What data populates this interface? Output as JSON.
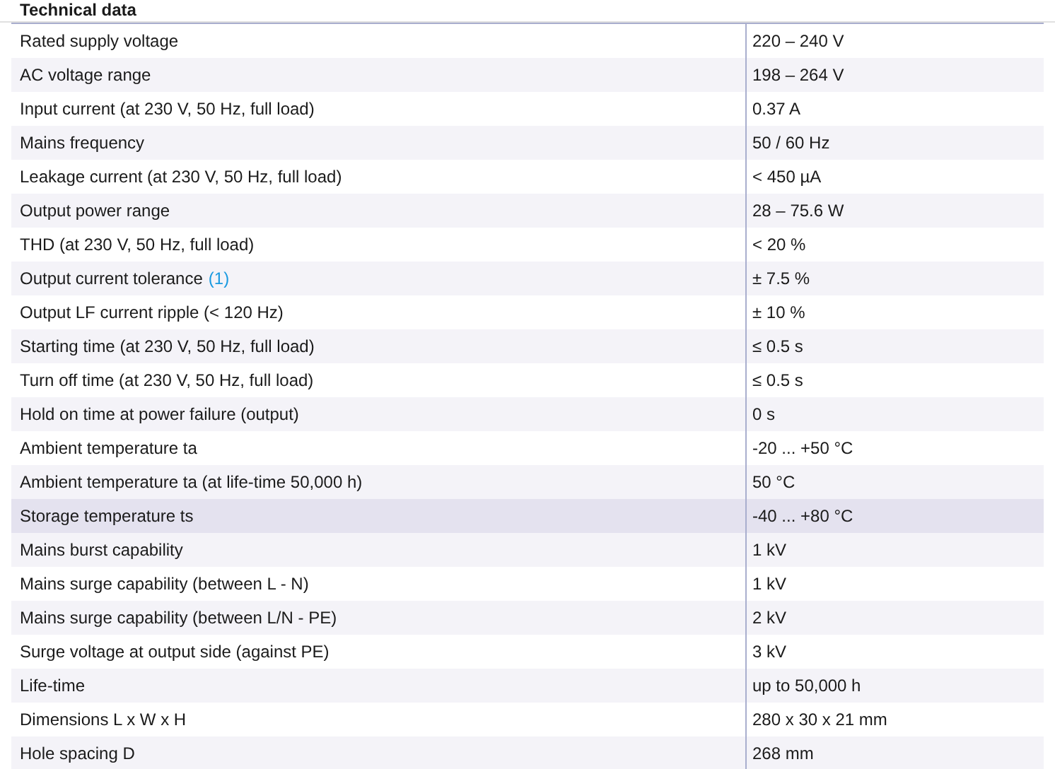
{
  "heading": "Technical data",
  "rows": [
    {
      "label": "Rated supply voltage",
      "value": "220 – 240 V",
      "selected": false
    },
    {
      "label": "AC voltage range",
      "value": "198 – 264 V",
      "selected": false
    },
    {
      "label": "Input current (at 230 V, 50 Hz, full load)",
      "value": "0.37 A",
      "selected": false
    },
    {
      "label": "Mains frequency",
      "value": "50 / 60 Hz",
      "selected": false
    },
    {
      "label": "Leakage current (at 230 V, 50 Hz, full load)",
      "value": "< 450 µA",
      "selected": false
    },
    {
      "label": "Output power range",
      "value": "28 – 75.6 W",
      "selected": false
    },
    {
      "label": "THD (at 230 V, 50 Hz, full load)",
      "value": "< 20 %",
      "selected": false
    },
    {
      "label": "Output current tolerance",
      "note": "(1)",
      "value": "± 7.5 %",
      "selected": false
    },
    {
      "label": "Output LF current ripple (< 120 Hz)",
      "value": "± 10 %",
      "selected": false
    },
    {
      "label": "Starting time (at 230 V, 50 Hz, full load)",
      "value": "≤ 0.5 s",
      "selected": false
    },
    {
      "label": "Turn off time (at 230 V, 50 Hz, full load)",
      "value": "≤ 0.5 s",
      "selected": false
    },
    {
      "label": "Hold on time at power failure (output)",
      "value": "0 s",
      "selected": false
    },
    {
      "label": "Ambient temperature ta",
      "value": "-20 ... +50 °C",
      "selected": false
    },
    {
      "label": "Ambient temperature ta (at life-time 50,000 h)",
      "value": "50 °C",
      "selected": false
    },
    {
      "label": "Storage temperature ts",
      "value": "-40 ... +80 °C",
      "selected": true
    },
    {
      "label": "Mains burst capability",
      "value": "1 kV",
      "selected": false
    },
    {
      "label": "Mains surge capability (between L - N)",
      "value": "1 kV",
      "selected": false
    },
    {
      "label": "Mains surge capability (between L/N - PE)",
      "value": "2 kV",
      "selected": false
    },
    {
      "label": "Surge voltage at output side (against PE)",
      "value": "3 kV",
      "selected": false
    },
    {
      "label": "Life-time",
      "value": "up to 50,000 h",
      "selected": false
    },
    {
      "label": "Dimensions L x W x H",
      "value": "280 x 30 x 21 mm",
      "selected": false
    },
    {
      "label": "Hole spacing D",
      "value": "268 mm",
      "selected": false
    }
  ]
}
